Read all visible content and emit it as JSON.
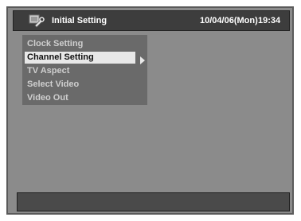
{
  "header": {
    "title": "Initial Setting",
    "date": "10/04/06(Mon)",
    "time": "19:34",
    "icon": "settings-wrench-icon"
  },
  "menu": {
    "items": [
      {
        "label": "Clock Setting"
      },
      {
        "label": "Channel Setting",
        "selected": true
      },
      {
        "label": "TV Aspect"
      },
      {
        "label": "Select Video"
      },
      {
        "label": "Video Out"
      }
    ]
  },
  "colors": {
    "screen_bg": "#8b8b8b",
    "titlebar_bg": "#3d3d3d",
    "menu_bg": "#6a6a6a",
    "selected_bg": "#e8e8e8",
    "text_dim": "#cfcfcf"
  }
}
